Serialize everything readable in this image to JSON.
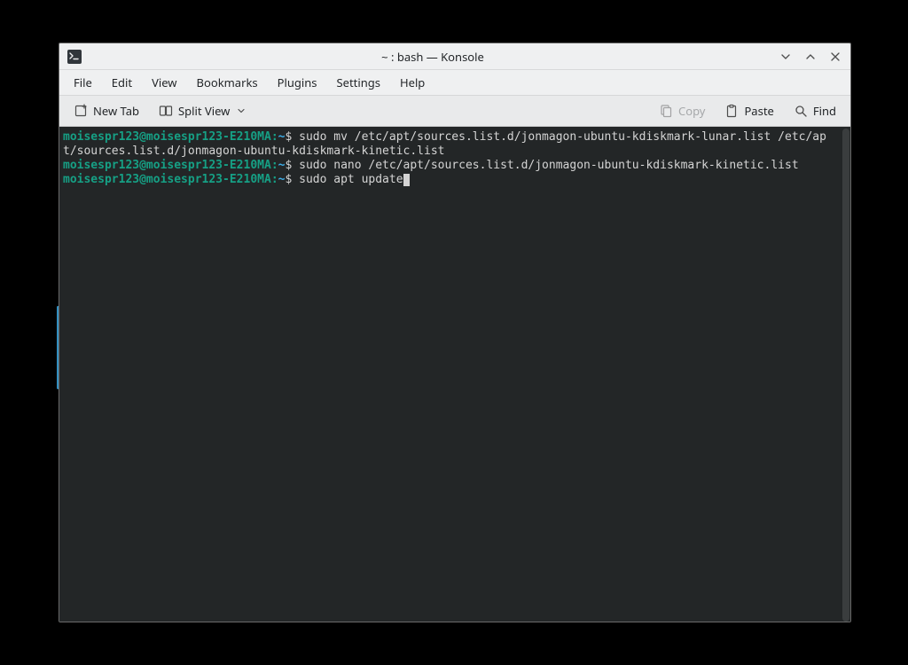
{
  "window": {
    "title": "~ : bash — Konsole"
  },
  "menubar": {
    "file": "File",
    "edit": "Edit",
    "view": "View",
    "bookmarks": "Bookmarks",
    "plugins": "Plugins",
    "settings": "Settings",
    "help": "Help"
  },
  "toolbar": {
    "new_tab": "New Tab",
    "split_view": "Split View",
    "copy": "Copy",
    "paste": "Paste",
    "find": "Find"
  },
  "terminal": {
    "prompt_user": "moisespr123@moisespr123-E210MA",
    "prompt_sep": ":",
    "prompt_path": "~",
    "prompt_char": "$",
    "lines": [
      {
        "cmd": "sudo mv /etc/apt/sources.list.d/jonmagon-ubuntu-kdiskmark-lunar.list /etc/apt/sources.list.d/jonmagon-ubuntu-kdiskmark-kinetic.list"
      },
      {
        "cmd": "sudo nano /etc/apt/sources.list.d/jonmagon-ubuntu-kdiskmark-kinetic.list"
      },
      {
        "cmd": "sudo apt update",
        "cursor": true
      }
    ]
  }
}
